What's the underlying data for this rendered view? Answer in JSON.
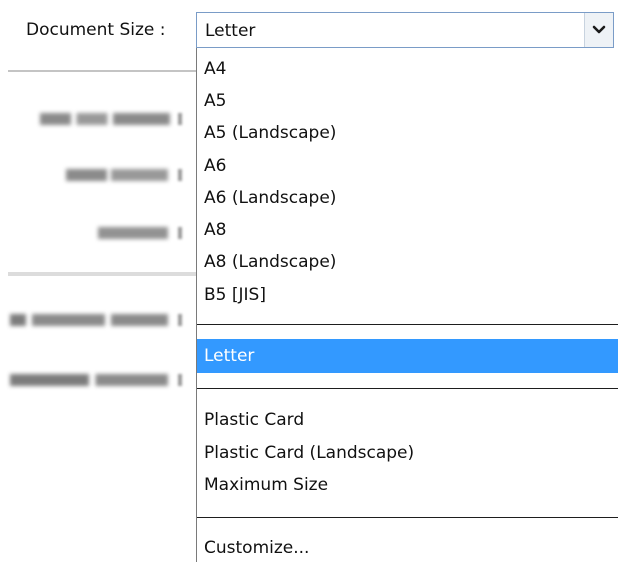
{
  "document_size": {
    "label": "Document Size :",
    "selected_value": "Letter",
    "icons": {
      "dropdown_arrow": "chevron-down-icon"
    }
  },
  "dropdown": {
    "groups": [
      [
        "A4",
        "A5",
        "A5 (Landscape)",
        "A6",
        "A6 (Landscape)",
        "A8",
        "A8 (Landscape)",
        "B5 [JIS]"
      ],
      [
        "Letter"
      ],
      [
        "Plastic Card",
        "Plastic Card (Landscape)",
        "Maximum Size"
      ],
      [
        "Customize..."
      ]
    ],
    "selected": "Letter",
    "highlight_color": "#3399ff"
  }
}
